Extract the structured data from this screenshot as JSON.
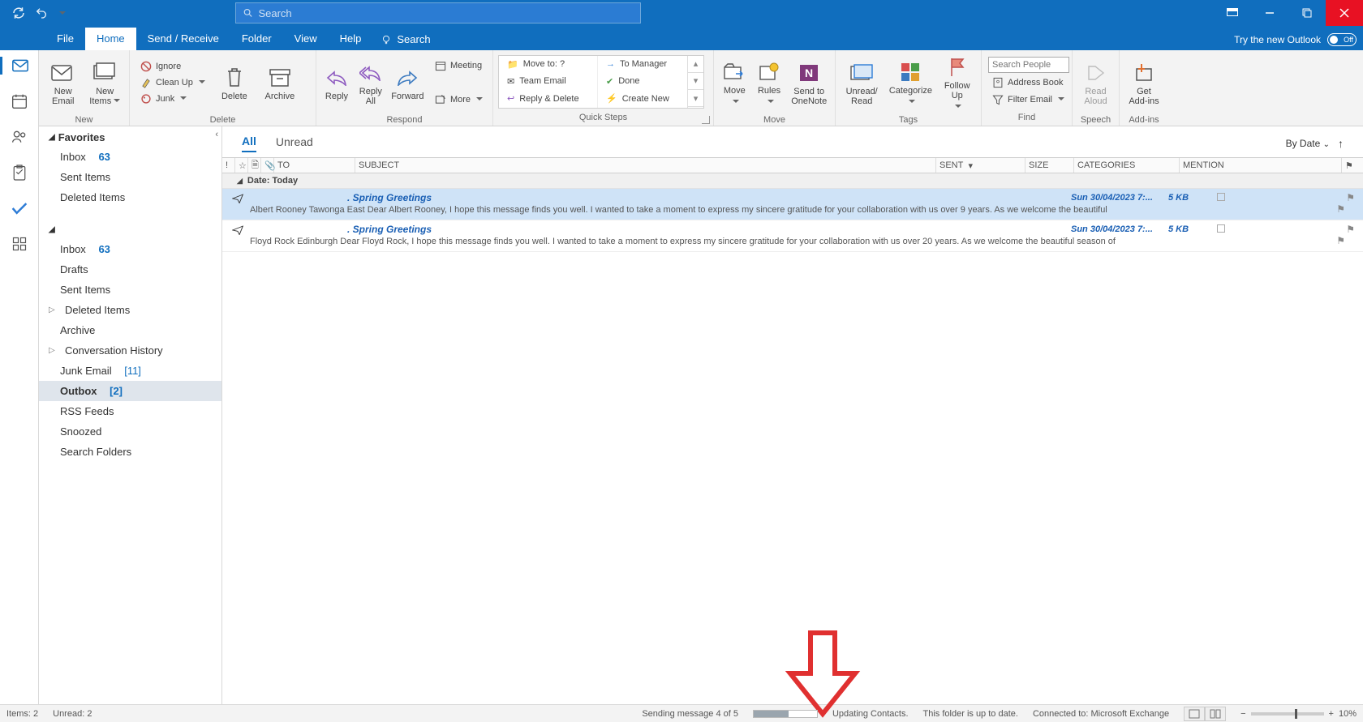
{
  "titlebar": {
    "search_placeholder": "Search"
  },
  "menutabs": {
    "file": "File",
    "home": "Home",
    "sendreceive": "Send / Receive",
    "folder": "Folder",
    "view": "View",
    "help": "Help",
    "search": "Search",
    "try_new": "Try the new Outlook",
    "toggle_state": "Off"
  },
  "ribbon": {
    "new": {
      "email": "New\nEmail",
      "items": "New\nItems",
      "group": "New"
    },
    "delete": {
      "ignore": "Ignore",
      "cleanup": "Clean Up",
      "junk": "Junk",
      "delete": "Delete",
      "archive": "Archive",
      "group": "Delete"
    },
    "respond": {
      "reply": "Reply",
      "replyall": "Reply\nAll",
      "forward": "Forward",
      "meeting": "Meeting",
      "more": "More",
      "group": "Respond"
    },
    "quicksteps": {
      "moveto": "Move to: ?",
      "tomanager": "To Manager",
      "teamemail": "Team Email",
      "done": "Done",
      "replydelete": "Reply & Delete",
      "createnew": "Create New",
      "group": "Quick Steps"
    },
    "move": {
      "move": "Move",
      "rules": "Rules",
      "onenote": "Send to\nOneNote",
      "group": "Move"
    },
    "tags": {
      "unread": "Unread/\nRead",
      "categorize": "Categorize",
      "followup": "Follow\nUp",
      "group": "Tags"
    },
    "find": {
      "search_people_ph": "Search People",
      "addressbook": "Address Book",
      "filter": "Filter Email",
      "group": "Find"
    },
    "speech": {
      "readaloud": "Read\nAloud",
      "group": "Speech"
    },
    "addins": {
      "get": "Get\nAdd-ins",
      "group": "Add-ins"
    }
  },
  "folders": {
    "favorites_hdr": "Favorites",
    "fav_inbox": "Inbox",
    "fav_inbox_count": "63",
    "fav_sent": "Sent Items",
    "fav_deleted": "Deleted Items",
    "inbox": "Inbox",
    "inbox_count": "63",
    "drafts": "Drafts",
    "sent": "Sent Items",
    "deleted": "Deleted Items",
    "archive": "Archive",
    "convhist": "Conversation History",
    "junk": "Junk Email",
    "junk_count": "[11]",
    "outbox": "Outbox",
    "outbox_count": "[2]",
    "rss": "RSS Feeds",
    "snoozed": "Snoozed",
    "searchfolders": "Search Folders"
  },
  "list": {
    "tab_all": "All",
    "tab_unread": "Unread",
    "sort_label": "By Date",
    "cols": {
      "to": "TO",
      "subject": "SUBJECT",
      "sent": "SENT",
      "size": "SIZE",
      "categories": "CATEGORIES",
      "mention": "MENTION"
    },
    "group_today": "Date: Today",
    "messages": [
      {
        "subject_suffix": ". Spring Greetings",
        "sent": "Sun 30/04/2023 7:...",
        "size": "5 KB",
        "preview": "Albert Rooney   Tawonga East   Dear Albert Rooney,   I hope this message finds you well. I wanted to take a moment to express my sincere gratitude for your collaboration with us over 9 years.   As we welcome the beautiful"
      },
      {
        "subject_suffix": ". Spring Greetings",
        "sent": "Sun 30/04/2023 7:...",
        "size": "5 KB",
        "preview": "Floyd Rock   Edinburgh   Dear Floyd Rock,   I hope this message finds you well. I wanted to take a moment to express my sincere gratitude for your collaboration with us over 20 years.   As we welcome the beautiful season of"
      }
    ]
  },
  "status": {
    "items": "Items: 2",
    "unread": "Unread: 2",
    "sending": "Sending message 4 of 5",
    "updating": "Updating Contacts.",
    "uptodate": "This folder is up to date.",
    "connected": "Connected to: Microsoft Exchange",
    "zoom": "10%"
  }
}
